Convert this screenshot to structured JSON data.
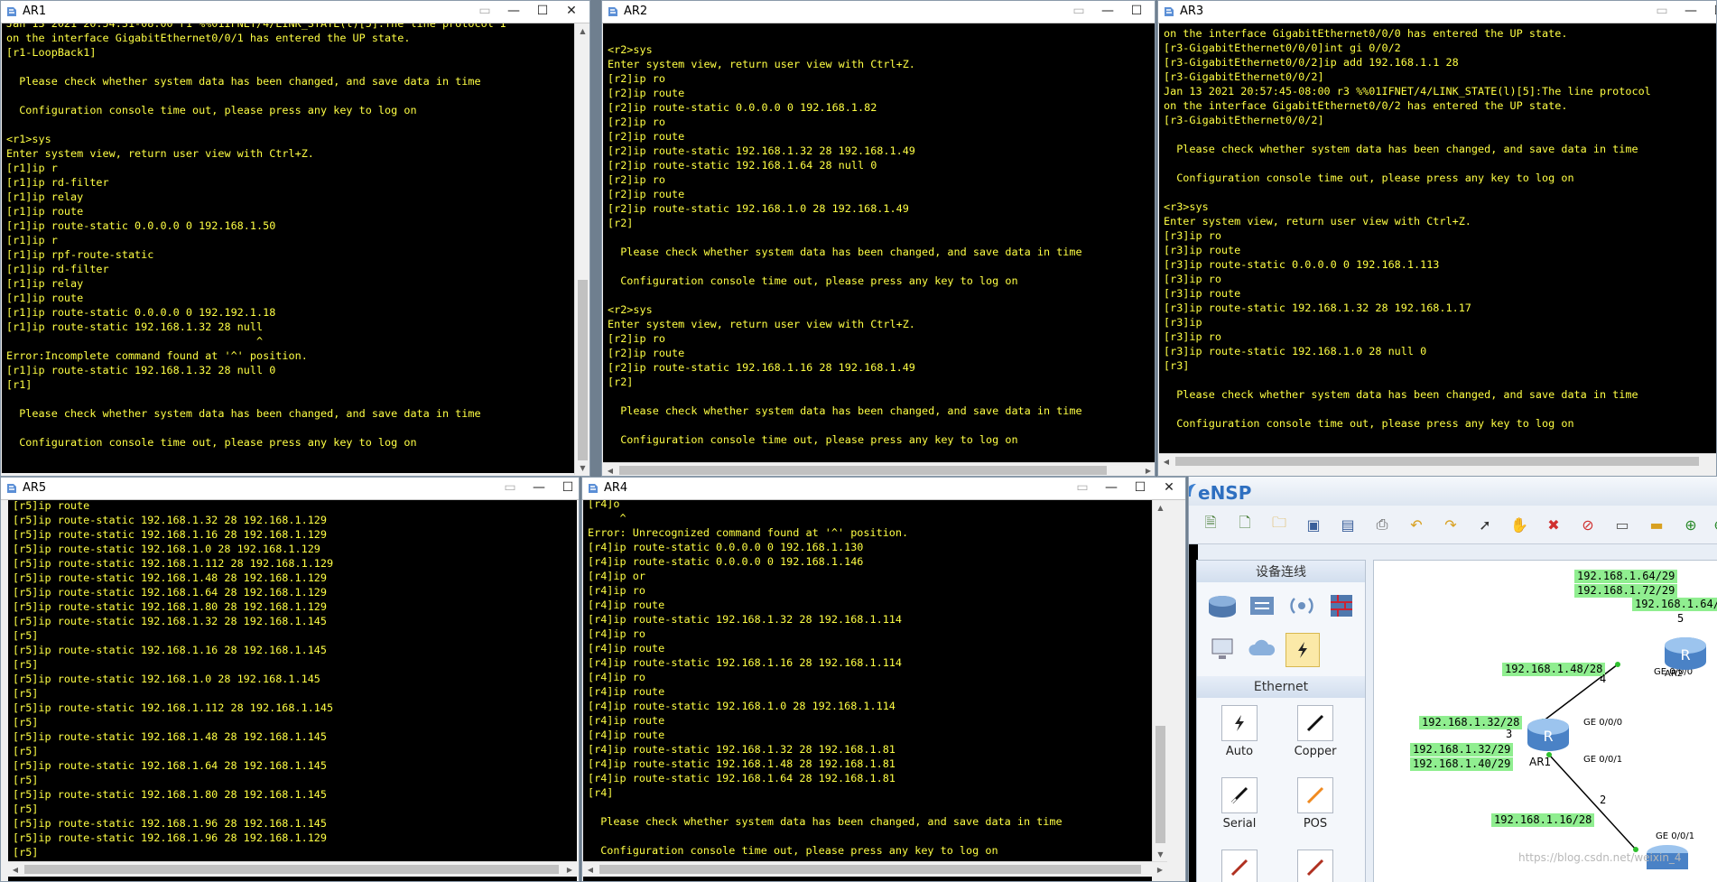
{
  "windows": {
    "ar1": {
      "title": "AR1",
      "lines": "Jan 13 2021 20:54:31-08:00 r1 %%01IFNET/4/LINK_STATE(l)[5]:The line protocol I\non the interface GigabitEthernet0/0/1 has entered the UP state.\n[r1-LoopBack1]\n\n  Please check whether system data has been changed, and save data in time\n\n  Configuration console time out, please press any key to log on\n\n<r1>sys\nEnter system view, return user view with Ctrl+Z.\n[r1]ip r\n[r1]ip rd-filter\n[r1]ip relay\n[r1]ip route\n[r1]ip route-static 0.0.0.0 0 192.168.1.50\n[r1]ip r\n[r1]ip rpf-route-static\n[r1]ip rd-filter\n[r1]ip relay\n[r1]ip route\n[r1]ip route-static 0.0.0.0 0 192.192.1.18\n[r1]ip route-static 192.168.1.32 28 null\n                                       ^\nError:Incomplete command found at '^' position.\n[r1]ip route-static 192.168.1.32 28 null 0\n[r1]\n\n  Please check whether system data has been changed, and save data in time\n\n  Configuration console time out, please press any key to log on"
    },
    "ar2": {
      "title": "AR2",
      "lines": "\n<r2>sys\nEnter system view, return user view with Ctrl+Z.\n[r2]ip ro\n[r2]ip route\n[r2]ip route-static 0.0.0.0 0 192.168.1.82\n[r2]ip ro\n[r2]ip route\n[r2]ip route-static 192.168.1.32 28 192.168.1.49\n[r2]ip route-static 192.168.1.64 28 null 0\n[r2]ip ro\n[r2]ip route\n[r2]ip route-static 192.168.1.0 28 192.168.1.49\n[r2]\n\n  Please check whether system data has been changed, and save data in time\n\n  Configuration console time out, please press any key to log on\n\n<r2>sys\nEnter system view, return user view with Ctrl+Z.\n[r2]ip ro\n[r2]ip route\n[r2]ip route-static 192.168.1.16 28 192.168.1.49\n[r2]\n\n  Please check whether system data has been changed, and save data in time\n\n  Configuration console time out, please press any key to log on"
    },
    "ar3": {
      "title": "AR3",
      "lines": "on the interface GigabitEthernet0/0/0 has entered the UP state.\n[r3-GigabitEthernet0/0/0]int gi 0/0/2\n[r3-GigabitEthernet0/0/2]ip add 192.168.1.1 28\n[r3-GigabitEthernet0/0/2]\nJan 13 2021 20:57:45-08:00 r3 %%01IFNET/4/LINK_STATE(l)[5]:The line protocol\non the interface GigabitEthernet0/0/2 has entered the UP state.\n[r3-GigabitEthernet0/0/2]\n\n  Please check whether system data has been changed, and save data in time\n\n  Configuration console time out, please press any key to log on\n\n<r3>sys\nEnter system view, return user view with Ctrl+Z.\n[r3]ip ro\n[r3]ip route\n[r3]ip route-static 0.0.0.0 0 192.168.1.113\n[r3]ip ro\n[r3]ip route\n[r3]ip route-static 192.168.1.32 28 192.168.1.17\n[r3]ip\n[r3]ip ro\n[r3]ip route-static 192.168.1.0 28 null 0\n[r3]\n\n  Please check whether system data has been changed, and save data in time\n\n  Configuration console time out, please press any key to log on"
    },
    "ar5": {
      "title": "AR5",
      "lines": "[r5]ip route\n[r5]ip route-static 192.168.1.32 28 192.168.1.129\n[r5]ip route-static 192.168.1.16 28 192.168.1.129\n[r5]ip route-static 192.168.1.0 28 192.168.1.129\n[r5]ip route-static 192.168.1.112 28 192.168.1.129\n[r5]ip route-static 192.168.1.48 28 192.168.1.129\n[r5]ip route-static 192.168.1.64 28 192.168.1.129\n[r5]ip route-static 192.168.1.80 28 192.168.1.129\n[r5]ip route-static 192.168.1.32 28 192.168.1.145\n[r5]\n[r5]ip route-static 192.168.1.16 28 192.168.1.145\n[r5]\n[r5]ip route-static 192.168.1.0 28 192.168.1.145\n[r5]\n[r5]ip route-static 192.168.1.112 28 192.168.1.145\n[r5]\n[r5]ip route-static 192.168.1.48 28 192.168.1.145\n[r5]\n[r5]ip route-static 192.168.1.64 28 192.168.1.145\n[r5]\n[r5]ip route-static 192.168.1.80 28 192.168.1.145\n[r5]\n[r5]ip route-static 192.168.1.96 28 192.168.1.145\n[r5]ip route-static 192.168.1.96 28 192.168.1.129\n[r5]"
    },
    "ar4": {
      "title": "AR4",
      "lines": "[r4]o\n     ^\nError: Unrecognized command found at '^' position.\n[r4]ip route-static 0.0.0.0 0 192.168.1.130\n[r4]ip route-static 0.0.0.0 0 192.168.1.146\n[r4]ip or\n[r4]ip ro\n[r4]ip route\n[r4]ip route-static 192.168.1.32 28 192.168.1.114\n[r4]ip ro\n[r4]ip route\n[r4]ip route-static 192.168.1.16 28 192.168.1.114\n[r4]ip ro\n[r4]ip route\n[r4]ip route-static 192.168.1.0 28 192.168.1.114\n[r4]ip route\n[r4]ip route\n[r4]ip route-static 192.168.1.32 28 192.168.1.81\n[r4]ip route-static 192.168.1.48 28 192.168.1.81\n[r4]ip route-static 192.168.1.64 28 192.168.1.81\n[r4]\n\n  Please check whether system data has been changed, and save data in time\n\n  Configuration console time out, please press any key to log on"
    }
  },
  "ensp": {
    "title": "eNSP",
    "panel_title": "设备连线",
    "ethernet_title": "Ethernet",
    "cables": [
      "Auto",
      "Copper",
      "Serial",
      "POS"
    ],
    "topology": {
      "labels": [
        "192.168.1.64/29",
        "192.168.1.72/29",
        "192.168.1.64/",
        "192.168.1.48/28",
        "192.168.1.32/28",
        "192.168.1.32/29",
        "192.168.1.40/29",
        "192.168.1.16/28"
      ],
      "numbers": [
        "5",
        "4",
        "3",
        "2"
      ],
      "ports": [
        "GE 0/0/0",
        "GE 0/0/0",
        "GE 0/0/1",
        "GE 0/0/1"
      ],
      "nodes": [
        "AR1",
        "AR2"
      ]
    },
    "watermark": "https://blog.csdn.net/weixin_4"
  }
}
